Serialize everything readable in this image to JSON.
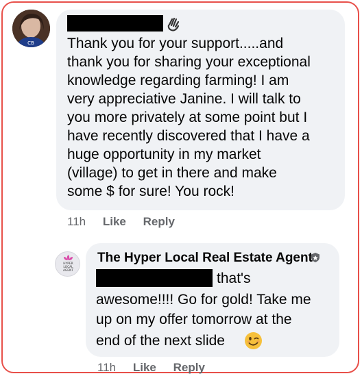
{
  "comment": {
    "text_lines": [
      "Thank you for your support.....and",
      "thank you for sharing your exceptional",
      "knowledge regarding farming! I am",
      "very appreciative Janine.  I will talk to",
      "you more privately at some point but I",
      "have recently discovered that I have a",
      "huge opportunity in my market",
      "(village) to get in there and make",
      "some $ for sure! You rock!"
    ],
    "time": "11h",
    "like_label": "Like",
    "reply_label": "Reply",
    "reaction_icon": "waving-hand-icon"
  },
  "reply": {
    "author": "The Hyper Local Real Estate Agent",
    "author_badge_icon": "shield-badge-icon",
    "avatar_text": [
      "HYPER",
      "LOCAL",
      "AGENT"
    ],
    "line1": "that's",
    "line2": "awesome!!!! Go for gold! Take me",
    "line3": "up on my offer tomorrow at the",
    "line4": "end of the next slide",
    "emoji_icon": "winking-face-icon",
    "time": "11h",
    "like_label": "Like",
    "reply_label": "Reply"
  },
  "colors": {
    "frame_border": "#e8504a",
    "bubble_bg": "#f0f2f5",
    "meta_text": "#65676b",
    "logo_pink": "#d94aa8"
  }
}
